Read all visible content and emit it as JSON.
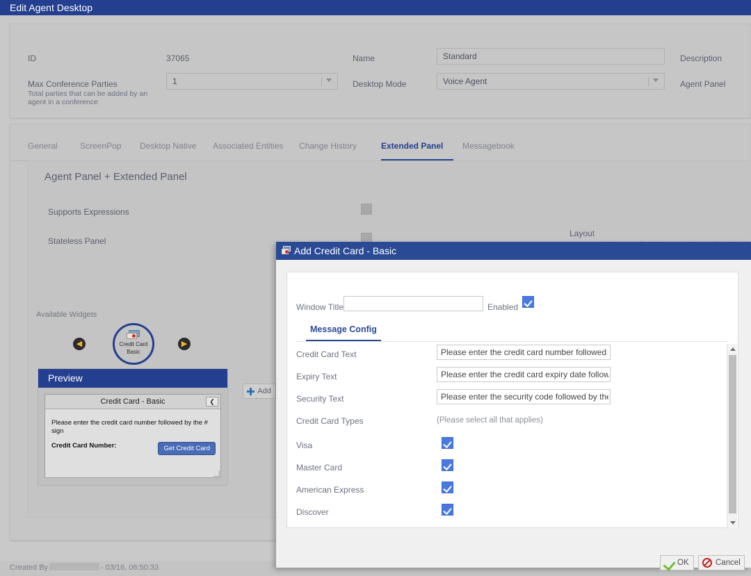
{
  "app": {
    "title": "Edit Agent Desktop"
  },
  "header": {
    "id_label": "ID",
    "id_value": "37065",
    "name_label": "Name",
    "name_value": "Standard",
    "description_label": "Description",
    "max_conf_label": "Max Conference Parties",
    "max_conf_sub": "Total parties that can be added by an agent in a conference",
    "max_conf_value": "1",
    "desktop_mode_label": "Desktop Mode",
    "desktop_mode_value": "Voice Agent",
    "agent_panel_label": "Agent Panel"
  },
  "tabs": [
    {
      "label": "General",
      "active": false
    },
    {
      "label": "ScreenPop",
      "active": false
    },
    {
      "label": "Desktop Native",
      "active": false
    },
    {
      "label": "Associated Entities",
      "active": false
    },
    {
      "label": "Change History",
      "active": false
    },
    {
      "label": "Extended Panel",
      "active": true
    },
    {
      "label": "Messagebook",
      "active": false
    }
  ],
  "panel": {
    "title": "Agent Panel + Extended Panel",
    "supports_expressions_label": "Supports Expressions",
    "stateless_panel_label": "Stateless Panel",
    "layout_title": "Layout",
    "layout_desc": "Layout provides two visual formats: Tabs to show the widgets in Tabs, Columns to show the widgets in two-column format."
  },
  "widgets": {
    "available_label": "Available Widgets",
    "prev_icon": "chevron-left-icon",
    "next_icon": "chevron-right-icon",
    "items": [
      {
        "name_line1": "Credit Card",
        "name_line2": "Basic",
        "icon": "credit-card-icon"
      }
    ],
    "add_label": "Add"
  },
  "preview": {
    "header": "Preview",
    "widget_title": "Credit Card - Basic",
    "collapse_icon": "chevron-left-icon",
    "body_text": "Please enter the credit card number followed by the # sign",
    "field_label": "Credit Card Number:",
    "button_label": "Get Credit Card"
  },
  "footer": {
    "created_by_label": "Created By",
    "created_by_user": "",
    "created_timestamp": "- 03/16, 06:50:33"
  },
  "dialog": {
    "title": "Add Credit Card - Basic",
    "icon": "credit-card-icon",
    "window_title_label": "Window Title",
    "window_title_value": "",
    "window_title_placeholder": "",
    "enabled_label": "Enabled",
    "enabled_checked": true,
    "tab_label": "Message Config",
    "fields": [
      {
        "label": "Credit Card Text",
        "value": "Please enter the credit card number followed by the # sign"
      },
      {
        "label": "Expiry Text",
        "value": "Please enter the credit card expiry date followed by the # sign"
      },
      {
        "label": "Security Text",
        "value": "Please enter the security code followed by the # sign"
      }
    ],
    "card_types_label": "Credit Card Types",
    "card_types_hint": "(Please select all that applies)",
    "card_types": [
      {
        "label": "Visa",
        "checked": true
      },
      {
        "label": "Master Card",
        "checked": true
      },
      {
        "label": "American Express",
        "checked": true
      },
      {
        "label": "Discover",
        "checked": true
      }
    ],
    "ok_label": "OK",
    "cancel_label": "Cancel"
  },
  "colors": {
    "brand_blue": "#243f8f",
    "dialog_blue": "#2a4a96",
    "checkbox_blue": "#4a7ae0",
    "page_gray": "#c9c9c9"
  }
}
